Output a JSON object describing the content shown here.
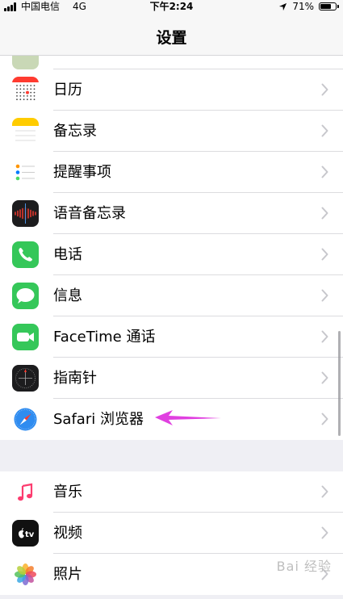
{
  "status_bar": {
    "carrier": "中国电信",
    "network": "4G",
    "time": "下午2:24",
    "battery_percent": "71%",
    "battery_level": 0.71
  },
  "nav": {
    "title": "设置"
  },
  "group1": [
    {
      "label": "日历",
      "icon": "calendar-icon"
    },
    {
      "label": "备忘录",
      "icon": "notes-icon"
    },
    {
      "label": "提醒事项",
      "icon": "reminders-icon"
    },
    {
      "label": "语音备忘录",
      "icon": "voice-memos-icon"
    },
    {
      "label": "电话",
      "icon": "phone-icon"
    },
    {
      "label": "信息",
      "icon": "messages-icon"
    },
    {
      "label": "FaceTime 通话",
      "icon": "facetime-icon"
    },
    {
      "label": "指南针",
      "icon": "compass-icon"
    },
    {
      "label": "Safari 浏览器",
      "icon": "safari-icon"
    }
  ],
  "group2": [
    {
      "label": "音乐",
      "icon": "music-icon"
    },
    {
      "label": "视频",
      "icon": "tv-icon"
    },
    {
      "label": "照片",
      "icon": "photos-icon"
    }
  ],
  "tv_icon_text": "tv",
  "watermark": "Bai 经验",
  "colors": {
    "accent_arrow": "#e040e0",
    "phone_green": "#35c759",
    "calendar_red": "#ff3b30"
  }
}
